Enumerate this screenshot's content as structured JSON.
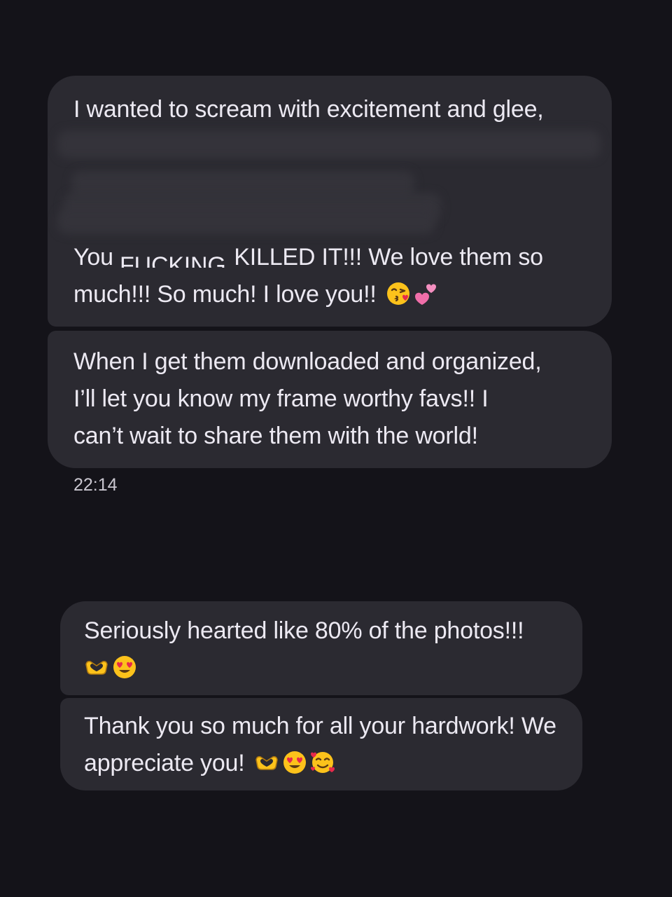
{
  "conversation": {
    "messages": [
      {
        "line1": "I wanted to scream with excitement and glee,",
        "line2_prefix": "You ",
        "line2_censored": "FUCKING",
        "line2_suffix": " KILLED IT!!! We love them so",
        "line3": "much!!! So much! I love you!!",
        "line3_emojis": [
          "kissing-face-with-heart-icon",
          "two-hearts-icon"
        ]
      },
      {
        "line1": "When I get them downloaded and organized,",
        "line2": "I’ll let you know my frame worthy favs!! I",
        "line3": "can’t wait to share them with the world!"
      },
      {
        "line1": "Seriously hearted like 80% of the photos!!!",
        "line2_emojis": [
          "heart-hands-icon",
          "heart-eyes-face-icon"
        ]
      },
      {
        "line1": "Thank you so much for all your hardwork! We",
        "line2": "appreciate you!",
        "line2_emojis": [
          "heart-hands-icon",
          "heart-eyes-face-icon",
          "smiling-face-with-hearts-icon"
        ]
      }
    ],
    "timestamp": "22:14"
  },
  "colors": {
    "background": "#141319",
    "bubble": "#2b2a31",
    "text": "#ece9f2",
    "timestamp": "#c9c6cf"
  }
}
